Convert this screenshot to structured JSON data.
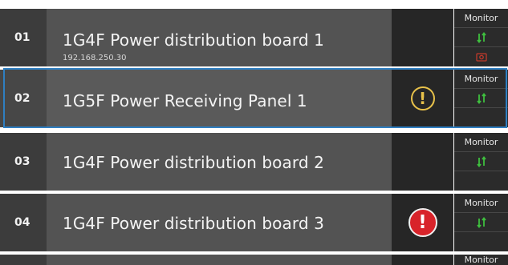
{
  "panels": [
    {
      "num": "01",
      "name": "1G4F Power distribution board 1",
      "ip": "192.168.250.30",
      "alert": "none",
      "status": {
        "label": "Monitor",
        "comm_icon": "comm-arrows-icon",
        "extra_icon": "camera-icon"
      }
    },
    {
      "num": "02",
      "name": "1G5F Power Receiving Panel 1",
      "alert": "warning",
      "alert_glyph": "!",
      "status": {
        "label": "Monitor",
        "comm_icon": "comm-arrows-icon"
      }
    },
    {
      "num": "03",
      "name": "1G4F Power distribution board 2",
      "alert": "none",
      "status": {
        "label": "Monitor",
        "comm_icon": "comm-arrows-icon"
      }
    },
    {
      "num": "04",
      "name": "1G4F Power distribution board 3",
      "alert": "error",
      "alert_glyph": "!",
      "status": {
        "label": "Monitor",
        "comm_icon": "comm-arrows-icon"
      }
    },
    {
      "status": {
        "label": "Monitor"
      }
    }
  ],
  "colors": {
    "comm_ok": "#3fbf3f",
    "warning": "#e7c14a",
    "error": "#d8232a",
    "selection": "#2f7fc2"
  }
}
